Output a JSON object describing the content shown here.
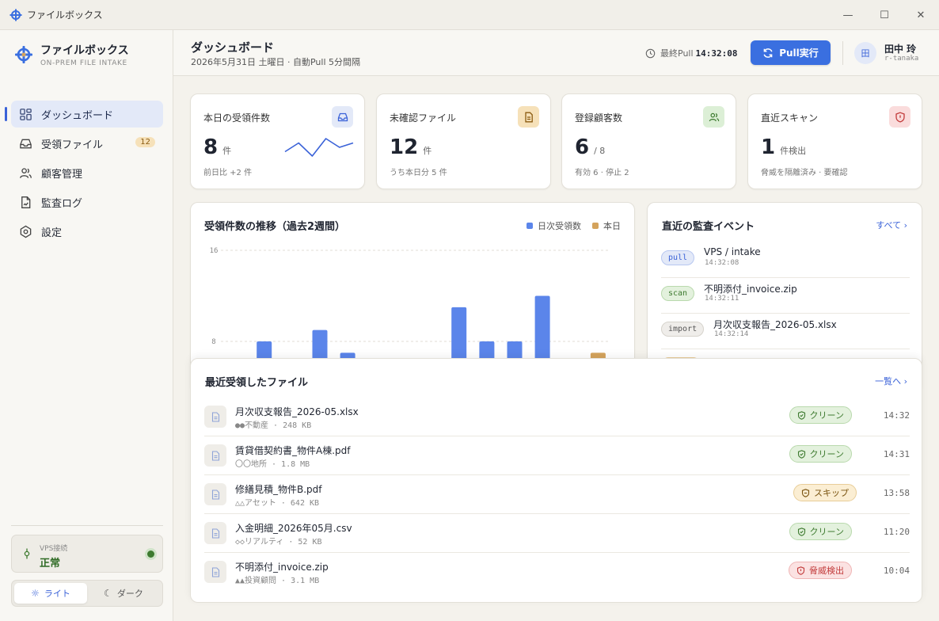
{
  "window": {
    "title": "ファイルボックス",
    "controls": [
      "—",
      "☐",
      "✕"
    ]
  },
  "brand": {
    "name": "ファイルボックス",
    "subtitle": "ON-PREM FILE INTAKE"
  },
  "nav": [
    {
      "label": "ダッシュボード",
      "icon": "dashboard-icon",
      "active": true
    },
    {
      "label": "受領ファイル",
      "icon": "inbox-icon",
      "badge": "12"
    },
    {
      "label": "顧客管理",
      "icon": "users-icon"
    },
    {
      "label": "監査ログ",
      "icon": "audit-log-icon"
    },
    {
      "label": "設定",
      "icon": "settings-icon"
    }
  ],
  "vps": {
    "label": "VPS接続",
    "status": "正常"
  },
  "theme": {
    "light": "ライト",
    "dark": "ダーク",
    "selected": "light"
  },
  "header": {
    "title": "ダッシュボード",
    "subtitle": "2026年5月31日 土曜日 · 自動Pull 5分間隔",
    "last_pull_label": "最終Pull",
    "last_pull_time": "14:32:08",
    "pull_button": "Pull実行",
    "user_initial": "田",
    "user_name": "田中 玲",
    "user_id": "r-tanaka"
  },
  "stats": [
    {
      "label": "本日の受領件数",
      "value": "8",
      "unit": "件",
      "foot": "前日比 +2 件",
      "icon": "inbox-icon",
      "icon_bg": "#e3e9f8",
      "icon_color": "#3a62d8",
      "sparkline": [
        3,
        5,
        2,
        6,
        4,
        5
      ]
    },
    {
      "label": "未確認ファイル",
      "value": "12",
      "unit": "件",
      "foot": "うち本日分 5 件",
      "icon": "document-icon",
      "icon_bg": "#f6e1b9",
      "icon_color": "#8a5a10"
    },
    {
      "label": "登録顧客数",
      "value": "6",
      "unit": "/ 8",
      "foot": "有効 6 · 停止 2",
      "icon": "users-icon",
      "icon_bg": "#dcefd6",
      "icon_color": "#3d7a2f"
    },
    {
      "label": "直近スキャン",
      "value": "1",
      "unit": "件検出",
      "foot": "脅威を隔離済み · 要確認",
      "icon": "shield-icon",
      "icon_bg": "#fadcdc",
      "icon_color": "#c23b3b"
    }
  ],
  "chart_data": {
    "type": "bar",
    "title": "受領件数の推移（過去2週間）",
    "legend": [
      "日次受領数",
      "本日"
    ],
    "colors": {
      "daily": "#5b85ea",
      "today": "#d4a35c"
    },
    "y_ticks": [
      "16",
      "8"
    ],
    "ylim": [
      0,
      16
    ],
    "values": [
      5,
      8,
      1.5,
      9,
      7,
      0,
      0,
      6,
      11,
      8,
      8,
      12,
      5,
      7
    ],
    "today_index": 13
  },
  "events": {
    "title": "直近の監査イベント",
    "all_link": "すべて",
    "items": [
      {
        "tag": "pull",
        "name": "VPS / intake",
        "time": "14:32:08",
        "tag_bg": "#e3e9f8",
        "tag_border": "#b7c7f0",
        "tag_color": "#3a62d8"
      },
      {
        "tag": "scan",
        "name": "不明添付_invoice.zip",
        "time": "14:32:11",
        "tag_bg": "#e3f1dd",
        "tag_border": "#b9d9ad",
        "tag_color": "#3d7a2f"
      },
      {
        "tag": "import",
        "name": "月次収支報告_2026-05.xlsx",
        "time": "14:32:14",
        "tag_bg": "#efedea",
        "tag_border": "#d6d3cc",
        "tag_color": "#555555"
      }
    ]
  },
  "files": {
    "title": "最近受領したファイル",
    "list_link": "一覧へ",
    "items": [
      {
        "name": "月次収支報告_2026-05.xlsx",
        "meta": "●●不動産 · 248 KB",
        "status": "クリーン",
        "status_type": "clean",
        "time": "14:32"
      },
      {
        "name": "賃貸借契約書_物件A棟.pdf",
        "meta": "〇〇地所 · 1.8 MB",
        "status": "クリーン",
        "status_type": "clean",
        "time": "14:31"
      },
      {
        "name": "修繕見積_物件B.pdf",
        "meta": "△△アセット · 642 KB",
        "status": "スキップ",
        "status_type": "skip",
        "time": "13:58"
      },
      {
        "name": "入金明細_2026年05月.csv",
        "meta": "◇◇リアルティ · 52 KB",
        "status": "クリーン",
        "status_type": "clean",
        "time": "11:20"
      },
      {
        "name": "不明添付_invoice.zip",
        "meta": "▲▲投資顧問 · 3.1 MB",
        "status": "脅威検出",
        "status_type": "threat",
        "time": "10:04"
      }
    ]
  }
}
